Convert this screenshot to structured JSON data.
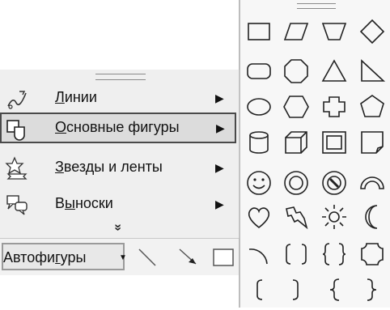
{
  "menu": {
    "items": [
      {
        "label_pre": "",
        "label_u": "Л",
        "label_post": "инии",
        "arrow": "▶",
        "icon": "lines-icon"
      },
      {
        "label_pre": "",
        "label_u": "О",
        "label_post": "сновные фигуры",
        "arrow": "▶",
        "icon": "basic-shapes-icon"
      },
      {
        "label_pre": "",
        "label_u": "З",
        "label_post": "везды и ленты",
        "arrow": "▶",
        "icon": "stars-banners-icon"
      },
      {
        "label_pre": "В",
        "label_u": "ы",
        "label_post": "носки",
        "arrow": "▶",
        "icon": "callouts-icon"
      }
    ],
    "more": "»"
  },
  "toolbar": {
    "autoshapes_pre": "Автофи",
    "autoshapes_u": "г",
    "autoshapes_post": "уры",
    "caret": "▼"
  },
  "palette": {
    "shapes": [
      "rectangle",
      "parallelogram",
      "trapezoid",
      "diamond",
      "rounded-rectangle",
      "octagon",
      "triangle",
      "right-triangle",
      "oval",
      "hexagon",
      "cross",
      "pentagon",
      "can",
      "cube",
      "bevel",
      "folded-corner",
      "smiley-face",
      "donut",
      "no-symbol",
      "block-arc",
      "heart",
      "lightning-bolt",
      "sun",
      "moon",
      "arc",
      "double-bracket",
      "double-brace",
      "plaque",
      "left-bracket",
      "right-bracket",
      "left-brace",
      "right-brace"
    ]
  }
}
